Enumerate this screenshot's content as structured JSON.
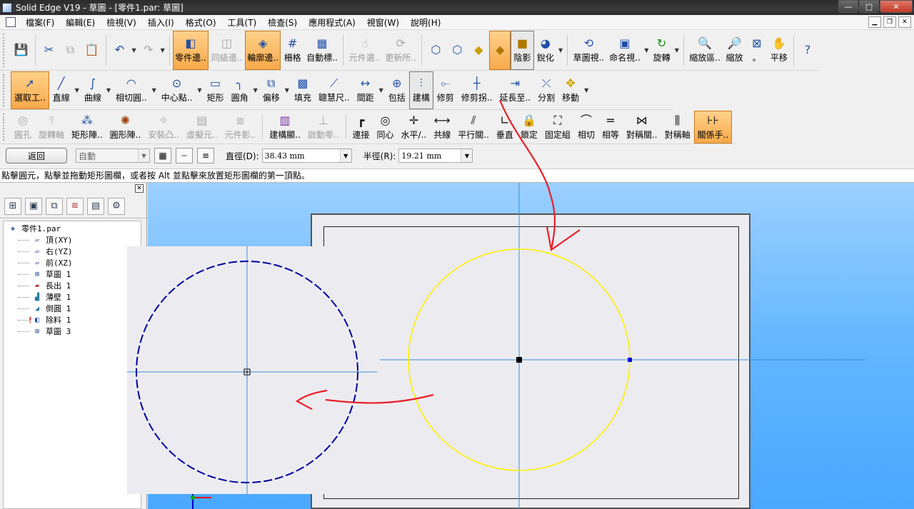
{
  "window": {
    "title": "Solid Edge V19 - 草圖 - [零件1.par: 草圖]",
    "buttons": [
      "—",
      "□",
      "✕"
    ]
  },
  "menu": {
    "items": [
      "檔案(F)",
      "編輯(E)",
      "檢視(V)",
      "插入(I)",
      "格式(O)",
      "工具(T)",
      "檢查(S)",
      "應用程式(A)",
      "視窗(W)",
      "說明(H)"
    ]
  },
  "toolbar_main": {
    "part_edge": "零件邊..",
    "hierarchy_edge": "同級邊..",
    "contour_edge": "輪廓邊..",
    "grid": "柵格",
    "auto_label": "自動標..",
    "component_select": "元件選..",
    "update_all": "更新所..",
    "shading": "陰影",
    "sharpen": "銳化",
    "sketch_view": "草圖視..",
    "named_view": "命名視..",
    "rotate": "旋轉",
    "zoom_area": "縮放區..",
    "zoom": "縮放",
    "fit": "。",
    "pan": "平移",
    "help": "?"
  },
  "toolbar_draw": {
    "select_tool": "選取工..",
    "line": "直線",
    "curve": "曲線",
    "tangent_arc": "相切圓..",
    "center_point": "中心點..",
    "rectangle": "矩形",
    "fillet": "圓角",
    "offset": "偏移",
    "fill": "填充",
    "smart_dimension": "聰慧尺..",
    "distance": "間距",
    "include": "包括",
    "construction": "建構",
    "trim": "修剪",
    "trim_corner": "修剪拐..",
    "extend": "延長至..",
    "split": "分割",
    "move": "移動"
  },
  "toolbar_relations": {
    "hole": "圓孔",
    "revolve_axis": "旋轉軸",
    "rect_pattern": "矩形陣..",
    "circ_pattern": "圓形陣..",
    "mount_boss": "安裝凸..",
    "virtual_element": "虛擬元..",
    "element_shadow": "元件影..",
    "construction_display": "建構顯..",
    "start_zero": "啟動零..",
    "connect": "連接",
    "concentric": "同心",
    "horizontal_vertical": "水平/..",
    "collinear": "共線",
    "parallel": "平行關..",
    "perpendicular": "垂直",
    "lock": "鎖定",
    "rigid_set": "固定組",
    "tangent": "相切",
    "equal": "相等",
    "symmetric": "對稱關..",
    "symmetry_axis": "對稱軸",
    "relation_handles": "關係手.."
  },
  "ribbon": {
    "back": "返回",
    "mode": "自動",
    "diameter_label": "直徑(D):",
    "diameter_value": "38.43 mm",
    "radius_label": "半徑(R):",
    "radius_value": "19.21 mm"
  },
  "prompt": "點擊圓元，點擊並拖動矩形圖欄，或者按 Alt 並點擊來放置矩形圖欄的第一頂點。",
  "tree": {
    "root": "零件1.par",
    "items": [
      "頂(XY)",
      "右(YZ)",
      "前(XZ)",
      "草圖 1",
      "長出 1",
      "薄壁 1",
      "倒圓 1",
      "除料 1",
      "草圖 3"
    ]
  },
  "colors": {
    "active_orange": "#f8a94a",
    "circle_main": "#ffee00",
    "circle_inset": "#0000a0",
    "axis_line": "#3a8fd8",
    "annotation_red": "#e8202a",
    "viewport_blue": "#63b6ff"
  }
}
